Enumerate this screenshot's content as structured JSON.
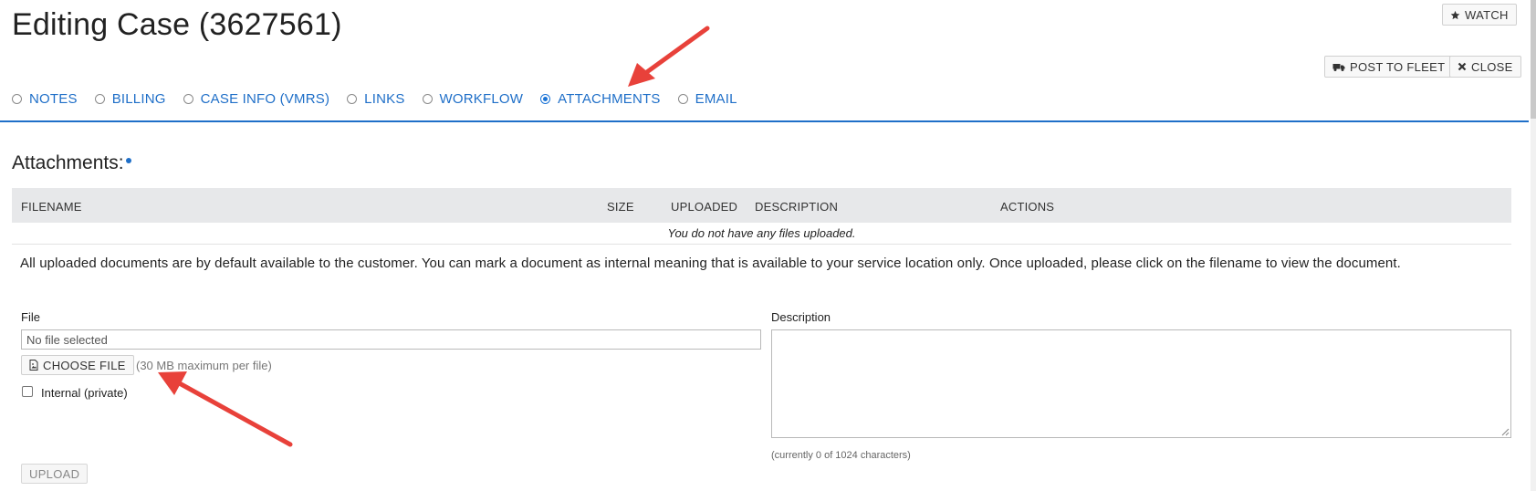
{
  "page": {
    "title": "Editing Case (3627561)"
  },
  "header_buttons": {
    "watch": "WATCH",
    "post_to_fleet": "POST TO FLEET",
    "close": "CLOSE"
  },
  "tabs": [
    {
      "label": "NOTES",
      "selected": false
    },
    {
      "label": "BILLING",
      "selected": false
    },
    {
      "label": "CASE INFO (VMRS)",
      "selected": false
    },
    {
      "label": "LINKS",
      "selected": false
    },
    {
      "label": "WORKFLOW",
      "selected": false
    },
    {
      "label": "ATTACHMENTS",
      "selected": true
    },
    {
      "label": "EMAIL",
      "selected": false
    }
  ],
  "attachments": {
    "title": "Attachments:",
    "columns": [
      "FILENAME",
      "SIZE",
      "UPLOADED",
      "DESCRIPTION",
      "ACTIONS"
    ],
    "empty_message": "You do not have any files uploaded.",
    "notice": "All uploaded documents are by default available to the customer. You can mark a document as internal meaning that is available to your service location only. Once uploaded, please click on the filename to view the document."
  },
  "form": {
    "file_label": "File",
    "file_value": "No file selected",
    "choose_file_label": "CHOOSE FILE",
    "file_hint": "(30 MB maximum per file)",
    "internal_label": "Internal (private)",
    "internal_checked": false,
    "description_label": "Description",
    "description_value": "",
    "char_count": "(currently 0 of 1024 characters)",
    "upload_label": "UPLOAD"
  },
  "colors": {
    "accent": "#1f6fc8",
    "annotation_arrow": "#e8413a",
    "table_header_bg": "#e7e8ea"
  }
}
